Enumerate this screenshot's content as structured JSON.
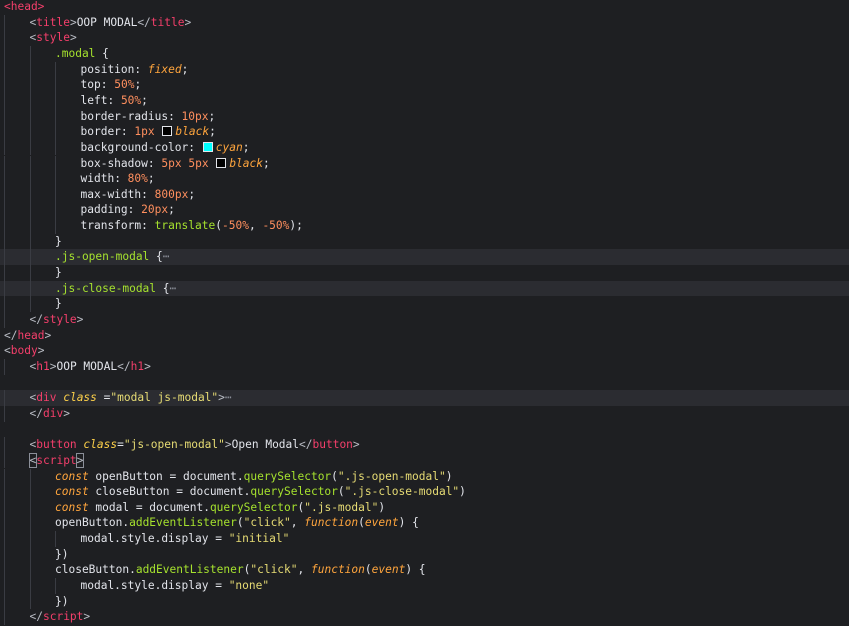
{
  "editor": {
    "lines": [
      {
        "indent": 0,
        "hl": false,
        "tokens": [
          {
            "t": "<head>",
            "c": "tag"
          }
        ]
      },
      {
        "indent": 1,
        "hl": false,
        "tokens": [
          {
            "t": "<",
            "c": "punc"
          },
          {
            "t": "title",
            "c": "tag"
          },
          {
            "t": ">",
            "c": "punc"
          },
          {
            "t": "OOP MODAL",
            "c": "text"
          },
          {
            "t": "</",
            "c": "punc"
          },
          {
            "t": "title",
            "c": "tag"
          },
          {
            "t": ">",
            "c": "punc"
          }
        ]
      },
      {
        "indent": 1,
        "hl": false,
        "tokens": [
          {
            "t": "<",
            "c": "punc"
          },
          {
            "t": "style",
            "c": "tag"
          },
          {
            "t": ">",
            "c": "punc"
          }
        ]
      },
      {
        "indent": 2,
        "hl": false,
        "tokens": [
          {
            "t": ".modal",
            "c": "sel"
          },
          {
            "t": " {",
            "c": "plain"
          }
        ]
      },
      {
        "indent": 3,
        "hl": false,
        "tokens": [
          {
            "t": "position",
            "c": "prop"
          },
          {
            "t": ": ",
            "c": "plain"
          },
          {
            "t": "fixed",
            "c": "kw"
          },
          {
            "t": ";",
            "c": "plain"
          }
        ]
      },
      {
        "indent": 3,
        "hl": false,
        "tokens": [
          {
            "t": "top",
            "c": "prop"
          },
          {
            "t": ": ",
            "c": "plain"
          },
          {
            "t": "50",
            "c": "num"
          },
          {
            "t": "%",
            "c": "unit"
          },
          {
            "t": ";",
            "c": "plain"
          }
        ]
      },
      {
        "indent": 3,
        "hl": false,
        "tokens": [
          {
            "t": "left",
            "c": "prop"
          },
          {
            "t": ": ",
            "c": "plain"
          },
          {
            "t": "50",
            "c": "num"
          },
          {
            "t": "%",
            "c": "unit"
          },
          {
            "t": ";",
            "c": "plain"
          }
        ]
      },
      {
        "indent": 3,
        "hl": false,
        "tokens": [
          {
            "t": "border-radius",
            "c": "prop"
          },
          {
            "t": ": ",
            "c": "plain"
          },
          {
            "t": "10",
            "c": "num"
          },
          {
            "t": "px",
            "c": "unit"
          },
          {
            "t": ";",
            "c": "plain"
          }
        ]
      },
      {
        "indent": 3,
        "hl": false,
        "tokens": [
          {
            "t": "border",
            "c": "prop"
          },
          {
            "t": ": ",
            "c": "plain"
          },
          {
            "t": "1",
            "c": "num"
          },
          {
            "t": "px",
            "c": "unit"
          },
          {
            "t": " ",
            "c": "plain"
          },
          {
            "sw": "#000000"
          },
          {
            "t": "black",
            "c": "kw"
          },
          {
            "t": ";",
            "c": "plain"
          }
        ]
      },
      {
        "indent": 3,
        "hl": false,
        "tokens": [
          {
            "t": "background-color",
            "c": "prop"
          },
          {
            "t": ": ",
            "c": "plain"
          },
          {
            "sw": "#00ffff"
          },
          {
            "t": "cyan",
            "c": "kw"
          },
          {
            "t": ";",
            "c": "plain"
          }
        ]
      },
      {
        "indent": 3,
        "hl": false,
        "tokens": [
          {
            "t": "box-shadow",
            "c": "prop"
          },
          {
            "t": ": ",
            "c": "plain"
          },
          {
            "t": "5",
            "c": "num"
          },
          {
            "t": "px",
            "c": "unit"
          },
          {
            "t": " ",
            "c": "plain"
          },
          {
            "t": "5",
            "c": "num"
          },
          {
            "t": "px",
            "c": "unit"
          },
          {
            "t": " ",
            "c": "plain"
          },
          {
            "sw": "#000000"
          },
          {
            "t": "black",
            "c": "kw"
          },
          {
            "t": ";",
            "c": "plain"
          }
        ]
      },
      {
        "indent": 3,
        "hl": false,
        "tokens": [
          {
            "t": "width",
            "c": "prop"
          },
          {
            "t": ": ",
            "c": "plain"
          },
          {
            "t": "80",
            "c": "num"
          },
          {
            "t": "%",
            "c": "unit"
          },
          {
            "t": ";",
            "c": "plain"
          }
        ]
      },
      {
        "indent": 3,
        "hl": false,
        "tokens": [
          {
            "t": "max-width",
            "c": "prop"
          },
          {
            "t": ": ",
            "c": "plain"
          },
          {
            "t": "800",
            "c": "num"
          },
          {
            "t": "px",
            "c": "unit"
          },
          {
            "t": ";",
            "c": "plain"
          }
        ]
      },
      {
        "indent": 3,
        "hl": false,
        "tokens": [
          {
            "t": "padding",
            "c": "prop"
          },
          {
            "t": ": ",
            "c": "plain"
          },
          {
            "t": "20",
            "c": "num"
          },
          {
            "t": "px",
            "c": "unit"
          },
          {
            "t": ";",
            "c": "plain"
          }
        ]
      },
      {
        "indent": 3,
        "hl": false,
        "tokens": [
          {
            "t": "transform",
            "c": "prop"
          },
          {
            "t": ": ",
            "c": "plain"
          },
          {
            "t": "translate",
            "c": "fn"
          },
          {
            "t": "(",
            "c": "plain"
          },
          {
            "t": "-50",
            "c": "num"
          },
          {
            "t": "%",
            "c": "unit"
          },
          {
            "t": ", ",
            "c": "plain"
          },
          {
            "t": "-50",
            "c": "num"
          },
          {
            "t": "%",
            "c": "unit"
          },
          {
            "t": ");",
            "c": "plain"
          }
        ]
      },
      {
        "indent": 2,
        "hl": false,
        "tokens": [
          {
            "t": "}",
            "c": "plain"
          }
        ]
      },
      {
        "indent": 2,
        "hl": true,
        "tokens": [
          {
            "t": ".js-open-modal",
            "c": "sel"
          },
          {
            "t": " {",
            "c": "plain"
          },
          {
            "t": "⋯",
            "c": "fold"
          }
        ]
      },
      {
        "indent": 2,
        "hl": false,
        "tokens": [
          {
            "t": "}",
            "c": "plain"
          }
        ]
      },
      {
        "indent": 2,
        "hl": true,
        "tokens": [
          {
            "t": ".js-close-modal",
            "c": "sel"
          },
          {
            "t": " {",
            "c": "plain"
          },
          {
            "t": "⋯",
            "c": "fold"
          }
        ]
      },
      {
        "indent": 2,
        "hl": false,
        "tokens": [
          {
            "t": "}",
            "c": "plain"
          }
        ]
      },
      {
        "indent": 1,
        "hl": false,
        "tokens": [
          {
            "t": "</",
            "c": "punc"
          },
          {
            "t": "style",
            "c": "tag"
          },
          {
            "t": ">",
            "c": "punc"
          }
        ]
      },
      {
        "indent": 0,
        "hl": false,
        "tokens": [
          {
            "t": "</",
            "c": "punc"
          },
          {
            "t": "head",
            "c": "tag"
          },
          {
            "t": ">",
            "c": "punc"
          }
        ]
      },
      {
        "indent": 0,
        "hl": false,
        "tokens": [
          {
            "t": "<",
            "c": "punc"
          },
          {
            "t": "body",
            "c": "tag"
          },
          {
            "t": ">",
            "c": "punc"
          }
        ]
      },
      {
        "indent": 1,
        "hl": false,
        "tokens": [
          {
            "t": "<",
            "c": "punc"
          },
          {
            "t": "h1",
            "c": "tag"
          },
          {
            "t": ">",
            "c": "punc"
          },
          {
            "t": "OOP MODAL",
            "c": "text"
          },
          {
            "t": "</",
            "c": "punc"
          },
          {
            "t": "h1",
            "c": "tag"
          },
          {
            "t": ">",
            "c": "punc"
          }
        ]
      },
      {
        "indent": 0,
        "hl": false,
        "tokens": []
      },
      {
        "indent": 1,
        "hl": true,
        "tokens": [
          {
            "t": "<",
            "c": "punc"
          },
          {
            "t": "div",
            "c": "tag"
          },
          {
            "t": " ",
            "c": "plain"
          },
          {
            "t": "class",
            "c": "attr"
          },
          {
            "t": " =",
            "c": "plain"
          },
          {
            "t": "\"modal js-modal\"",
            "c": "str"
          },
          {
            "t": ">",
            "c": "punc"
          },
          {
            "t": "⋯",
            "c": "fold"
          }
        ]
      },
      {
        "indent": 1,
        "hl": false,
        "tokens": [
          {
            "t": "</",
            "c": "punc"
          },
          {
            "t": "div",
            "c": "tag"
          },
          {
            "t": ">",
            "c": "punc"
          }
        ]
      },
      {
        "indent": 0,
        "hl": false,
        "tokens": []
      },
      {
        "indent": 1,
        "hl": false,
        "tokens": [
          {
            "t": "<",
            "c": "punc"
          },
          {
            "t": "button",
            "c": "tag"
          },
          {
            "t": " ",
            "c": "plain"
          },
          {
            "t": "class",
            "c": "attr"
          },
          {
            "t": "=",
            "c": "plain"
          },
          {
            "t": "\"js-open-modal\"",
            "c": "str"
          },
          {
            "t": ">",
            "c": "punc"
          },
          {
            "t": "Open Modal",
            "c": "text"
          },
          {
            "t": "</",
            "c": "punc"
          },
          {
            "t": "button",
            "c": "tag"
          },
          {
            "t": ">",
            "c": "punc"
          }
        ]
      },
      {
        "indent": 1,
        "hl": false,
        "tokens": [
          {
            "t": "<",
            "c": "punc",
            "box": true
          },
          {
            "t": "script",
            "c": "tag"
          },
          {
            "t": ">",
            "c": "punc",
            "box": true
          }
        ]
      },
      {
        "indent": 2,
        "hl": false,
        "tokens": [
          {
            "t": "const",
            "c": "kw"
          },
          {
            "t": " openButton = document.",
            "c": "plain"
          },
          {
            "t": "querySelector",
            "c": "fn"
          },
          {
            "t": "(",
            "c": "plain"
          },
          {
            "t": "\".js-open-modal\"",
            "c": "str"
          },
          {
            "t": ")",
            "c": "plain"
          }
        ]
      },
      {
        "indent": 2,
        "hl": false,
        "tokens": [
          {
            "t": "const",
            "c": "kw"
          },
          {
            "t": " closeButton = document.",
            "c": "plain"
          },
          {
            "t": "querySelector",
            "c": "fn"
          },
          {
            "t": "(",
            "c": "plain"
          },
          {
            "t": "\".js-close-modal\"",
            "c": "str"
          },
          {
            "t": ")",
            "c": "plain"
          }
        ]
      },
      {
        "indent": 2,
        "hl": false,
        "tokens": [
          {
            "t": "const",
            "c": "kw"
          },
          {
            "t": " modal = document.",
            "c": "plain"
          },
          {
            "t": "querySelector",
            "c": "fn"
          },
          {
            "t": "(",
            "c": "plain"
          },
          {
            "t": "\".js-modal\"",
            "c": "str"
          },
          {
            "t": ")",
            "c": "plain"
          }
        ]
      },
      {
        "indent": 2,
        "hl": false,
        "tokens": [
          {
            "t": "openButton.",
            "c": "plain"
          },
          {
            "t": "addEventListener",
            "c": "fn"
          },
          {
            "t": "(",
            "c": "plain"
          },
          {
            "t": "\"click\"",
            "c": "str"
          },
          {
            "t": ", ",
            "c": "plain"
          },
          {
            "t": "function",
            "c": "func"
          },
          {
            "t": "(",
            "c": "plain"
          },
          {
            "t": "event",
            "c": "param"
          },
          {
            "t": ") {",
            "c": "plain"
          }
        ]
      },
      {
        "indent": 3,
        "hl": false,
        "tokens": [
          {
            "t": "modal.style.display = ",
            "c": "plain"
          },
          {
            "t": "\"initial\"",
            "c": "str"
          }
        ]
      },
      {
        "indent": 2,
        "hl": false,
        "tokens": [
          {
            "t": "})",
            "c": "plain"
          }
        ]
      },
      {
        "indent": 2,
        "hl": false,
        "tokens": [
          {
            "t": "closeButton.",
            "c": "plain"
          },
          {
            "t": "addEventListener",
            "c": "fn"
          },
          {
            "t": "(",
            "c": "plain"
          },
          {
            "t": "\"click\"",
            "c": "str"
          },
          {
            "t": ", ",
            "c": "plain"
          },
          {
            "t": "function",
            "c": "func"
          },
          {
            "t": "(",
            "c": "plain"
          },
          {
            "t": "event",
            "c": "param"
          },
          {
            "t": ") {",
            "c": "plain"
          }
        ]
      },
      {
        "indent": 3,
        "hl": false,
        "tokens": [
          {
            "t": "modal.style.display = ",
            "c": "plain"
          },
          {
            "t": "\"none\"",
            "c": "str"
          }
        ]
      },
      {
        "indent": 2,
        "hl": false,
        "tokens": [
          {
            "t": "})",
            "c": "plain"
          }
        ]
      },
      {
        "indent": 1,
        "hl": false,
        "tokens": [
          {
            "t": "</",
            "c": "punc"
          },
          {
            "t": "script",
            "c": "tag"
          },
          {
            "t": ">",
            "c": "punc"
          }
        ]
      }
    ]
  }
}
